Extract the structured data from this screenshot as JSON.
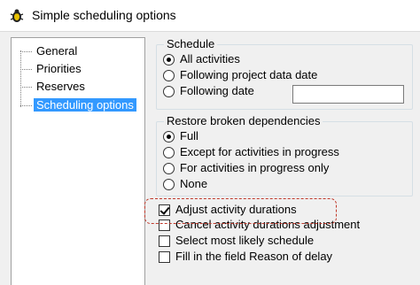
{
  "window": {
    "title": "Simple scheduling options",
    "icon": "bug-icon"
  },
  "tree": {
    "items": [
      {
        "label": "General",
        "selected": false
      },
      {
        "label": "Priorities",
        "selected": false
      },
      {
        "label": "Reserves",
        "selected": false
      },
      {
        "label": "Scheduling options",
        "selected": true
      }
    ]
  },
  "schedule": {
    "title": "Schedule",
    "options": [
      {
        "label": "All activities",
        "checked": true
      },
      {
        "label": "Following project data date",
        "checked": false
      },
      {
        "label": "Following date",
        "checked": false
      }
    ],
    "date_value": ""
  },
  "restore": {
    "title": "Restore broken dependencies",
    "options": [
      {
        "label": "Full",
        "checked": true
      },
      {
        "label": "Except for activities in progress",
        "checked": false
      },
      {
        "label": "For activities in progress only",
        "checked": false
      },
      {
        "label": "None",
        "checked": false
      }
    ]
  },
  "checkboxes": [
    {
      "label": "Adjust activity durations",
      "checked": true
    },
    {
      "label": "Cancel activity durations adjustment",
      "checked": false
    },
    {
      "label": "Select most likely schedule",
      "checked": false
    },
    {
      "label": "Fill in the field Reason of delay",
      "checked": false
    }
  ],
  "colors": {
    "selection": "#3399ff",
    "highlight_border": "#c0392b"
  }
}
